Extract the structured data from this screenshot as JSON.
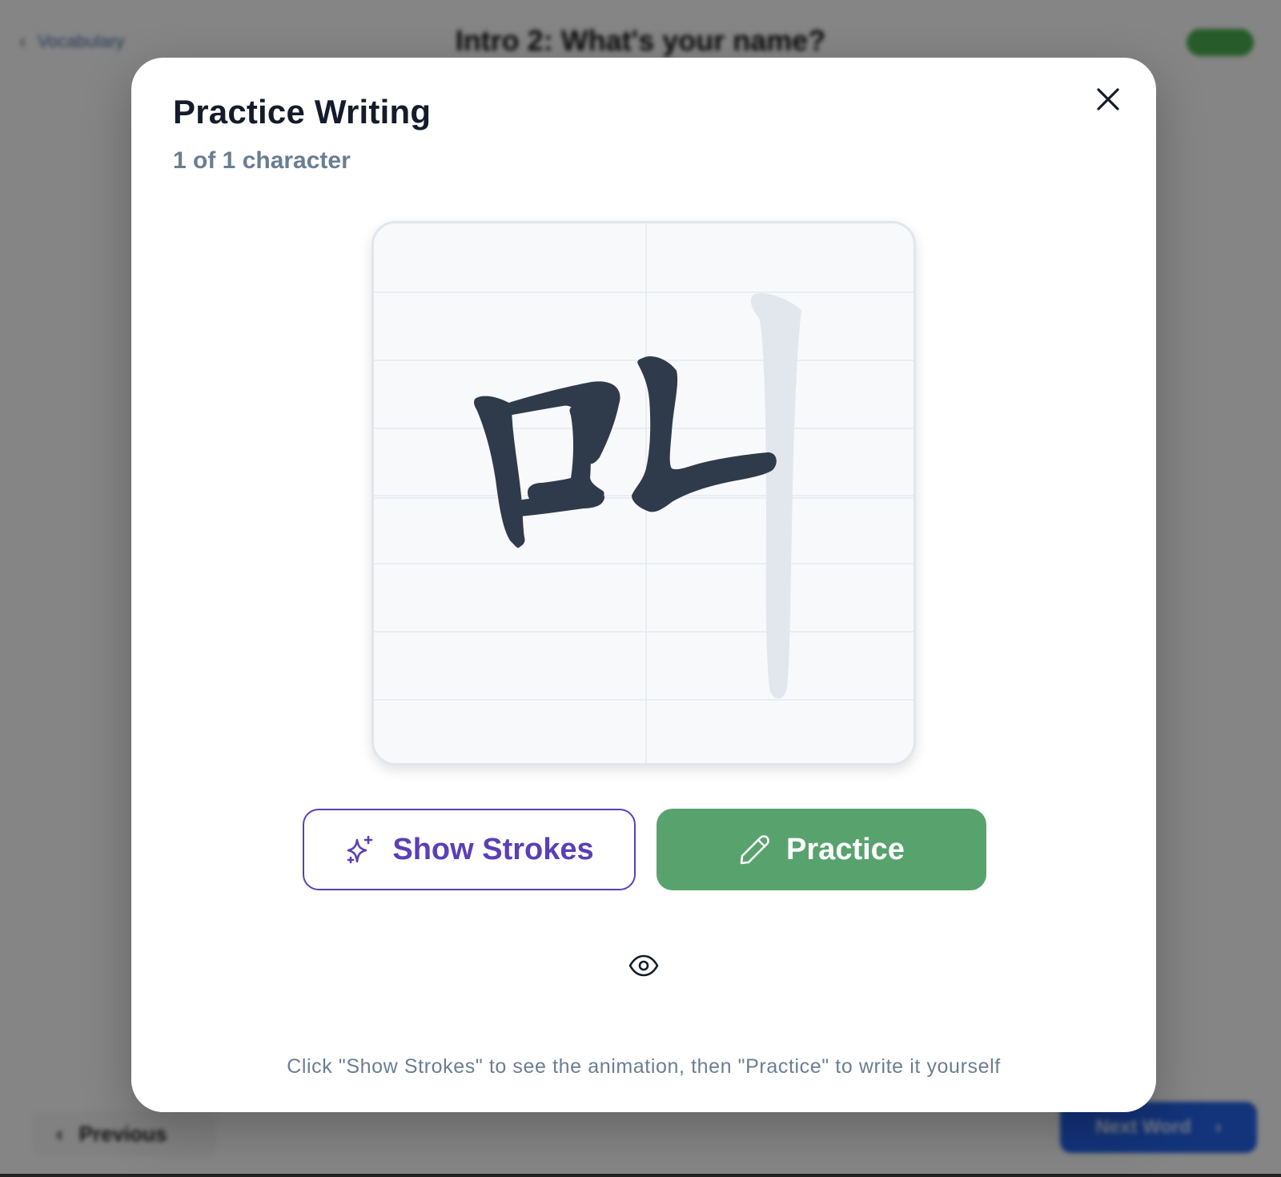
{
  "background": {
    "back_label": "Vocabulary",
    "title": "Intro 2: What's your name?",
    "badge": "",
    "previous_label": "Previous",
    "next_label": "Next Word"
  },
  "modal": {
    "title": "Practice Writing",
    "subtitle": "1 of 1 character",
    "character": "미",
    "show_strokes_label": "Show Strokes",
    "practice_label": "Practice",
    "hint": "Click \"Show Strokes\" to see the animation, then \"Practice\" to write it yourself"
  },
  "icons": {
    "close": "close-icon",
    "sparkle": "sparkle-icon",
    "pencil": "pencil-icon",
    "eye": "eye-icon"
  },
  "colors": {
    "accent_purple": "#5b3fb5",
    "practice_green": "#58a36d",
    "stroke_dark": "#2f3a4b",
    "stroke_ghost": "#e2e7ee"
  }
}
